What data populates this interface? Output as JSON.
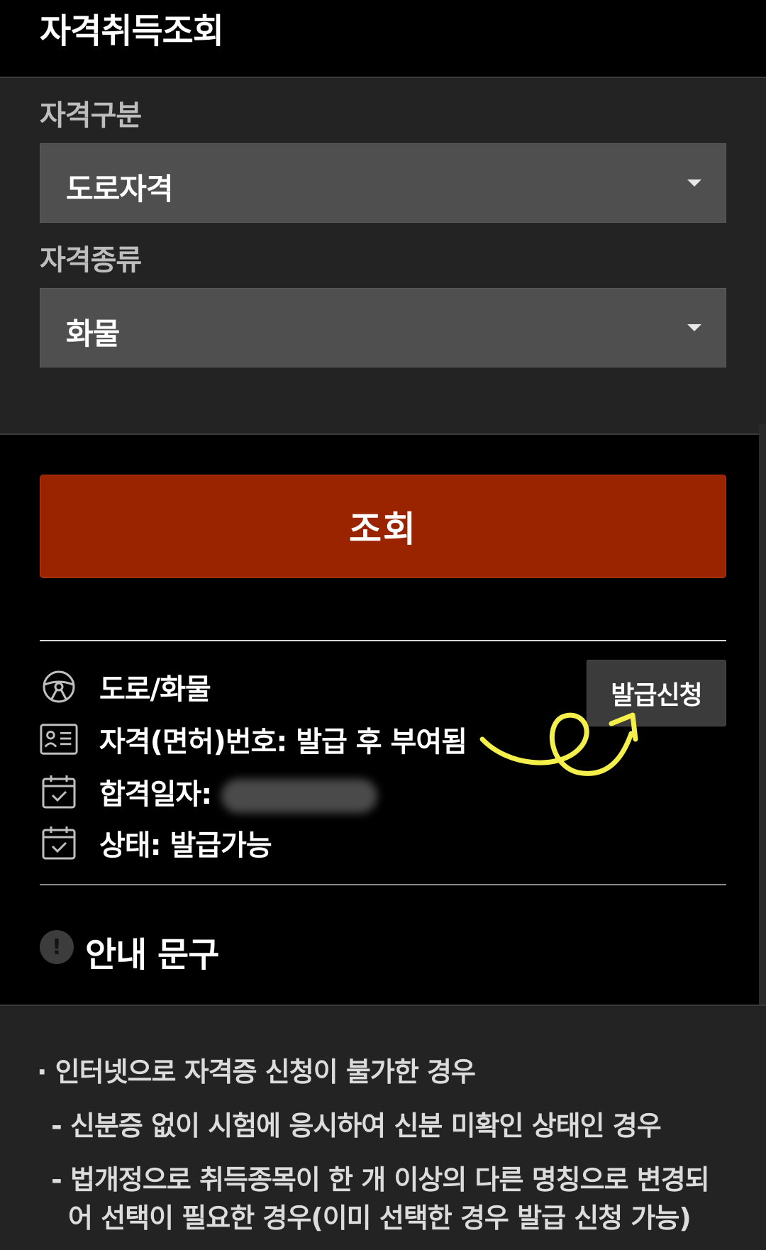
{
  "header": {
    "title": "자격취득조회"
  },
  "filters": {
    "category_label": "자격구분",
    "category_value": "도로자격",
    "type_label": "자격종류",
    "type_value": "화물"
  },
  "search_button": "조회",
  "result": {
    "title": "도로/화물",
    "license_number": "자격(면허)번호: 발급 후 부여됨",
    "pass_date_label": "합격일자:",
    "status": "상태: 발급가능",
    "issue_button": "발급신청"
  },
  "notice": {
    "title": "안내 문구",
    "badge": "!",
    "lines": [
      "· 인터넷으로 자격증 신청이 불가한 경우",
      "- 신분증 없이 시험에 응시하여 신분 미확인 상태인 경우",
      "- 법개정으로 취득종목이 한 개 이상의 다른 명칭으로 변경되",
      "어 선택이 필요한 경우(이미 선택한 경우 발급 신청 가능)"
    ]
  },
  "colors": {
    "background": "#000000",
    "panel": "#232323",
    "select": "#4f4f4f",
    "accent": "#9a2400",
    "annotation": "#f4ef4a"
  }
}
